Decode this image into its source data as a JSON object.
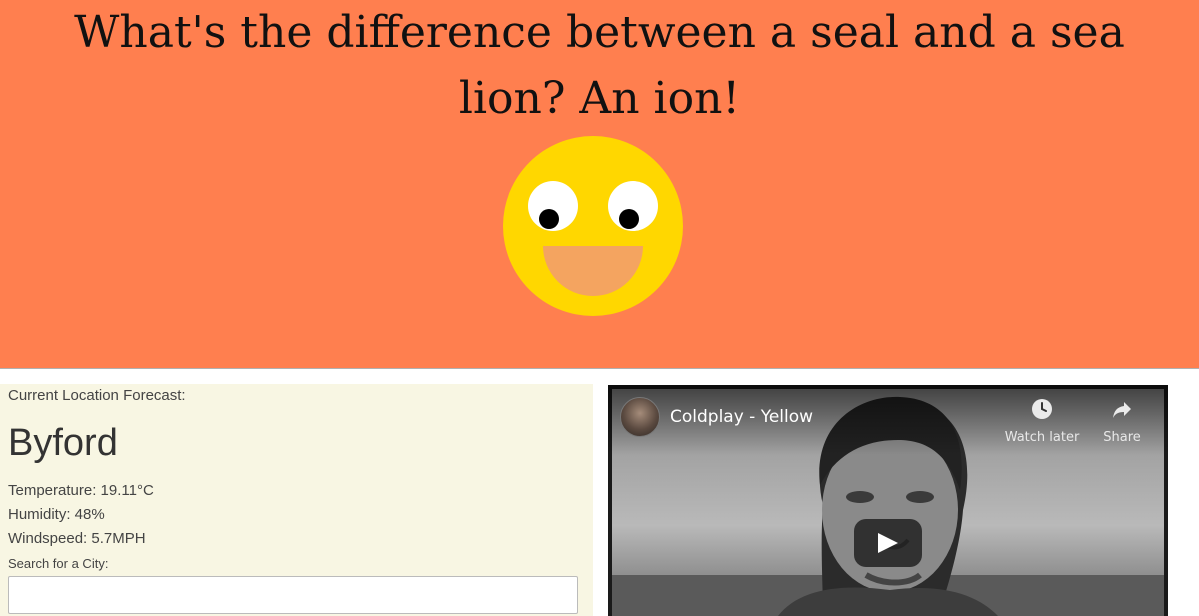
{
  "joke": {
    "text": "What's the difference between a seal and a sea lion? An ion!"
  },
  "smiley": {
    "face_color": "#ffd700",
    "mouth_color": "#f4a460"
  },
  "hero": {
    "background": "#ff7f4f"
  },
  "weather": {
    "heading": "Current Location Forecast:",
    "city": "Byford",
    "temperature": "Temperature: 19.11°C",
    "humidity": "Humidity: 48%",
    "windspeed": "Windspeed: 5.7MPH",
    "search_label": "Search for a City:",
    "search_value": ""
  },
  "video": {
    "title": "Coldplay - Yellow",
    "watch_later_label": "Watch later",
    "share_label": "Share",
    "icons": {
      "watch_later": "clock-icon",
      "share": "share-arrow-icon",
      "play": "play-icon"
    }
  }
}
